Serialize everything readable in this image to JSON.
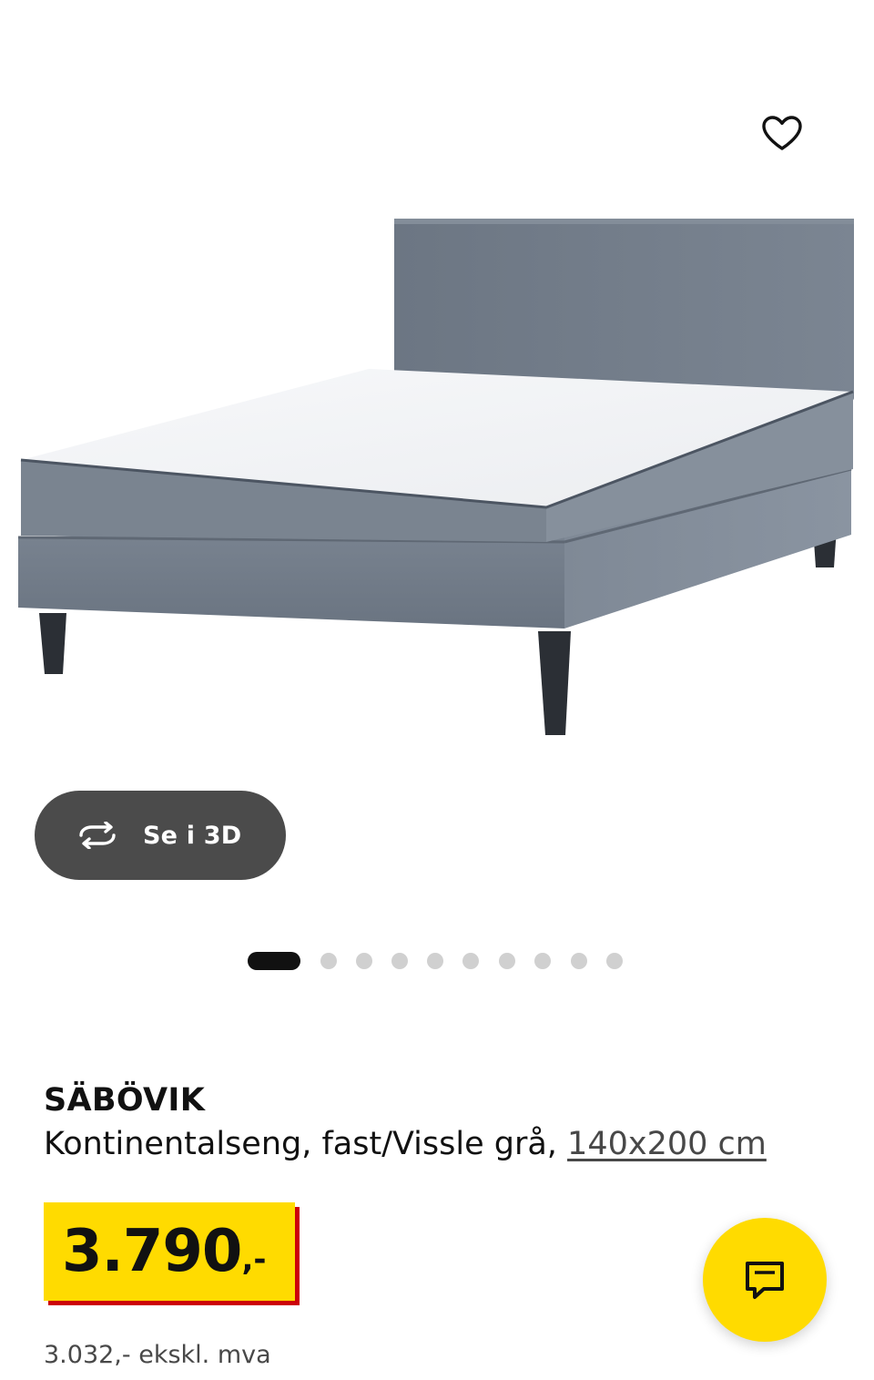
{
  "gallery": {
    "image_alt": "SÄBÖVIK kontinentalseng",
    "favourite_icon": "heart-outline-icon",
    "view_3d": {
      "icon": "rotate-3d-icon",
      "label": "Se i 3D"
    },
    "slide_count": 10,
    "active_slide": 0
  },
  "product": {
    "name": "SÄBÖVIK",
    "description": "Kontinentalseng, fast/Vissle grå, ",
    "size": "140x200 cm"
  },
  "price": {
    "value": "3.790",
    "suffix": ",-",
    "ex_vat": "3.032,- ekskl. mva"
  },
  "chat": {
    "icon": "chat-bubble-icon"
  },
  "colors": {
    "price_yellow": "#ffdb00",
    "price_shadow_red": "#cc0008",
    "chat_yellow": "#ffdb00",
    "pill_dark": "#4b4b4b",
    "fabric_grey": "#6f7987"
  }
}
